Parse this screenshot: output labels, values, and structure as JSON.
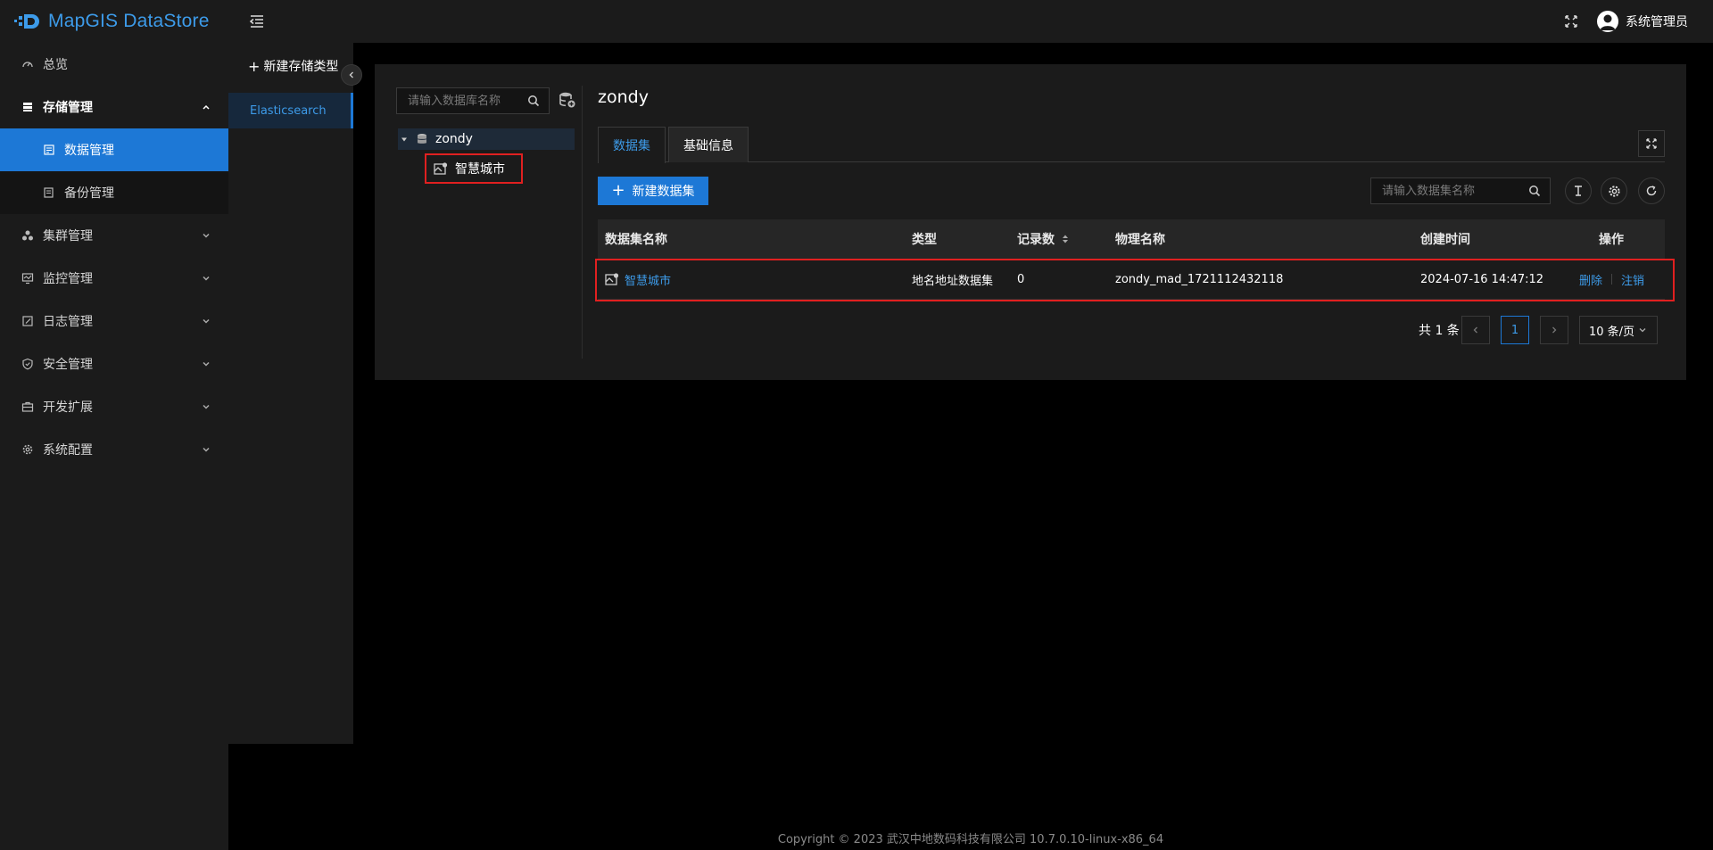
{
  "app": {
    "title": "MapGIS DataStore"
  },
  "sidebar": {
    "items": [
      {
        "label": "总览",
        "icon": "dashboard-icon"
      },
      {
        "label": "存储管理",
        "icon": "storage-icon",
        "open": true,
        "children": [
          {
            "label": "数据管理",
            "icon": "data-manage-icon",
            "active": true
          },
          {
            "label": "备份管理",
            "icon": "backup-icon"
          }
        ]
      },
      {
        "label": "集群管理",
        "icon": "cluster-icon"
      },
      {
        "label": "监控管理",
        "icon": "monitor-icon"
      },
      {
        "label": "日志管理",
        "icon": "log-icon"
      },
      {
        "label": "安全管理",
        "icon": "shield-icon"
      },
      {
        "label": "开发扩展",
        "icon": "toolbox-icon"
      },
      {
        "label": "系统配置",
        "icon": "gear-icon"
      }
    ]
  },
  "header": {
    "user_name": "系统管理员"
  },
  "type_panel": {
    "new_type_label": "新建存储类型",
    "types": [
      "Elasticsearch"
    ]
  },
  "tree": {
    "search_placeholder": "请输入数据库名称",
    "root_label": "zondy",
    "child_label": "智慧城市"
  },
  "main": {
    "db_title": "zondy",
    "tabs": [
      "数据集",
      "基础信息"
    ],
    "new_dataset_label": "新建数据集",
    "dataset_search_placeholder": "请输入数据集名称"
  },
  "table": {
    "columns": [
      "数据集名称",
      "类型",
      "记录数",
      "物理名称",
      "创建时间",
      "操作"
    ],
    "rows": [
      {
        "name": "智慧城市",
        "type": "地名地址数据集",
        "count": "0",
        "physical": "zondy_mad_1721112432118",
        "created": "2024-07-16 14:47:12",
        "actions": [
          "删除",
          "注销"
        ]
      }
    ]
  },
  "pagination": {
    "total": "共 1 条",
    "current": "1",
    "page_size": "10 条/页"
  },
  "footer": {
    "copyright": "Copyright © 2023 武汉中地数码科技有限公司 10.7.0.10-linux-x86_64"
  },
  "colors": {
    "accent": "#1d78d6",
    "link": "#3d9be9",
    "highlight": "#e02020",
    "panel": "#1b1b1b"
  }
}
